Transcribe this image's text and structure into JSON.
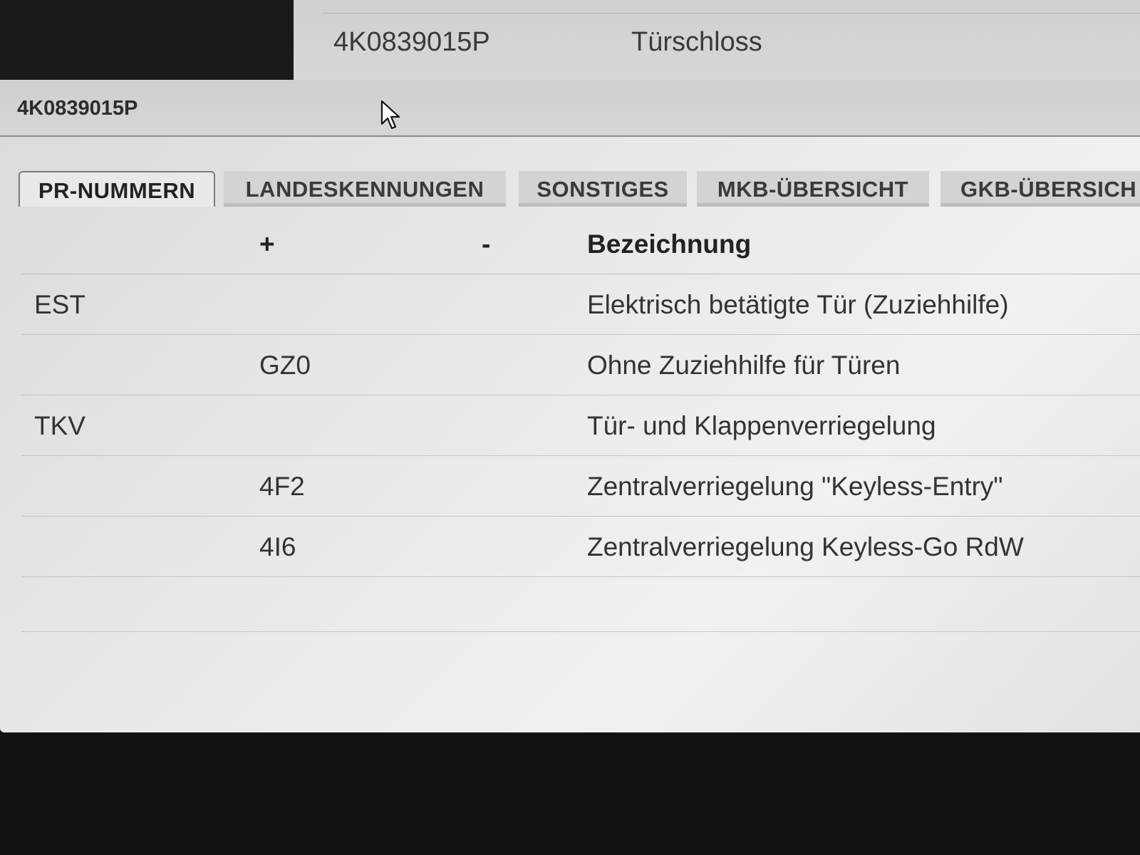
{
  "background_row": {
    "part_number": "4K0839015P",
    "name": "Türschloss"
  },
  "dialog": {
    "title": "4K0839015P"
  },
  "tabs": [
    {
      "label": "PR-NUMMERN",
      "active": true
    },
    {
      "label": "LANDESKENNUNGEN",
      "active": false
    },
    {
      "label": "SONSTIGES",
      "active": false
    },
    {
      "label": "MKB-ÜBERSICHT",
      "active": false
    },
    {
      "label": "GKB-ÜBERSICH",
      "active": false
    }
  ],
  "table": {
    "headers": {
      "code": "",
      "plus": "+",
      "minus": "-",
      "description": "Bezeichnung"
    },
    "rows": [
      {
        "code": "EST",
        "plus": "",
        "minus": "",
        "description": "Elektrisch betätigte Tür (Zuziehhilfe)"
      },
      {
        "code": "",
        "plus": "GZ0",
        "minus": "",
        "description": "Ohne Zuziehhilfe für Türen"
      },
      {
        "code": "TKV",
        "plus": "",
        "minus": "",
        "description": "Tür- und Klappenverriegelung"
      },
      {
        "code": "",
        "plus": "4F2",
        "minus": "",
        "description": "Zentralverriegelung \"Keyless-Entry\""
      },
      {
        "code": "",
        "plus": "4I6",
        "minus": "",
        "description": "Zentralverriegelung Keyless-Go RdW"
      }
    ]
  },
  "icons": {
    "cursor": "mouse-pointer-icon"
  }
}
